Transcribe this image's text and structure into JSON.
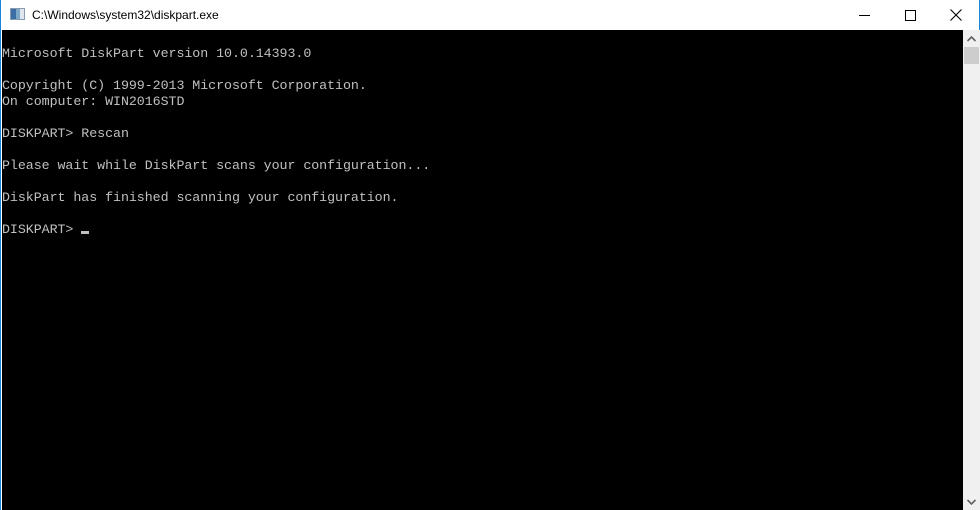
{
  "window": {
    "title": "C:\\Windows\\system32\\diskpart.exe",
    "icon": "console-app-icon",
    "controls": {
      "minimize": "minimize-icon",
      "maximize": "maximize-icon",
      "close": "close-icon"
    }
  },
  "console": {
    "lines": [
      "Microsoft DiskPart version 10.0.14393.0",
      "",
      "Copyright (C) 1999-2013 Microsoft Corporation.",
      "On computer: WIN2016STD",
      "",
      "DISKPART> Rescan",
      "",
      "Please wait while DiskPart scans your configuration...",
      "",
      "DiskPart has finished scanning your configuration.",
      "",
      "DISKPART> "
    ],
    "colors": {
      "background": "#000000",
      "foreground": "#c0c0c0"
    }
  },
  "scrollbar": {
    "up": "chevron-up-icon",
    "down": "chevron-down-icon"
  }
}
